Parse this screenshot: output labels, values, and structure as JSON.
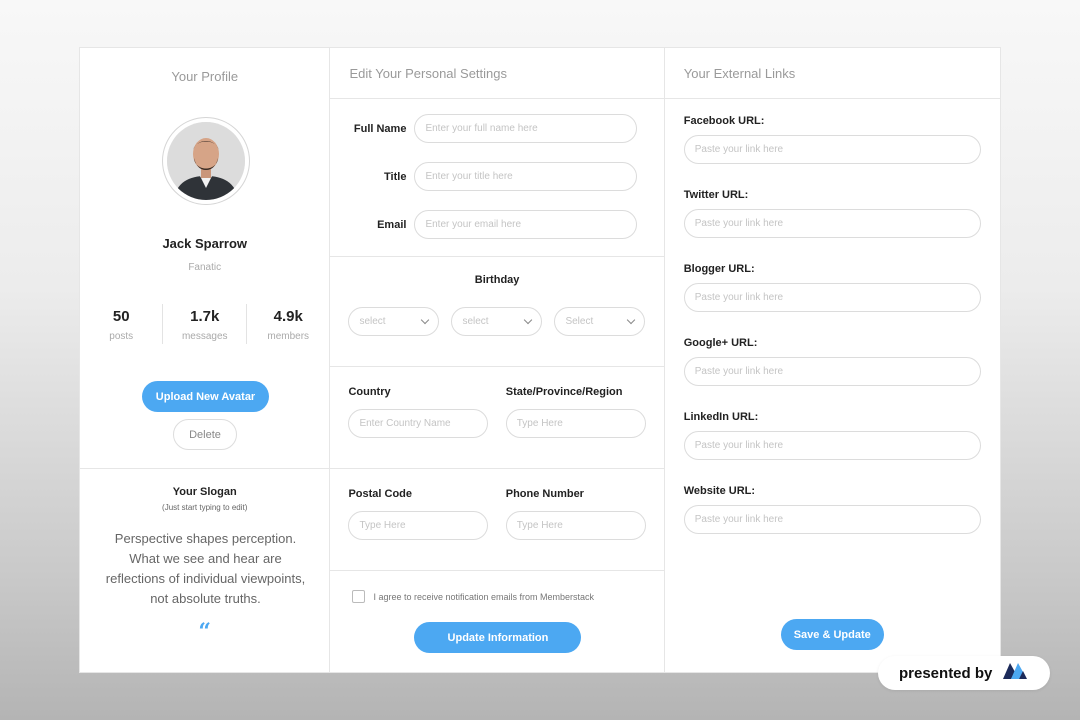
{
  "profile": {
    "heading": "Your Profile",
    "name": "Jack Sparrow",
    "role": "Fanatic",
    "stats": [
      {
        "value": "50",
        "label": "posts"
      },
      {
        "value": "1.7k",
        "label": "messages"
      },
      {
        "value": "4.9k",
        "label": "members"
      }
    ],
    "upload_label": "Upload New Avatar",
    "delete_label": "Delete"
  },
  "slogan": {
    "title": "Your Slogan",
    "hint": "(Just start typing to edit)",
    "text": "Perspective shapes perception. What we see and hear are reflections of individual viewpoints, not absolute truths."
  },
  "settings": {
    "heading": "Edit Your Personal Settings",
    "full_name": {
      "label": "Full Name",
      "placeholder": "Enter your full name here"
    },
    "title": {
      "label": "Title",
      "placeholder": "Enter your title here"
    },
    "email": {
      "label": "Email",
      "placeholder": "Enter your email here"
    },
    "birthday": {
      "label": "Birthday",
      "selects": [
        "select",
        "select",
        "Select"
      ]
    },
    "country": {
      "label": "Country",
      "placeholder": "Enter Country Name"
    },
    "state": {
      "label": "State/Province/Region",
      "placeholder": "Type Here"
    },
    "postal": {
      "label": "Postal Code",
      "placeholder": "Type Here"
    },
    "phone": {
      "label": "Phone Number",
      "placeholder": "Type Here"
    },
    "agree_text": "I agree to receive notification emails from Memberstack",
    "update_label": "Update Information"
  },
  "links": {
    "heading": "Your External Links",
    "items": [
      {
        "label": "Facebook URL:",
        "placeholder": "Paste your link here"
      },
      {
        "label": "Twitter URL:",
        "placeholder": "Paste your link here"
      },
      {
        "label": "Blogger URL:",
        "placeholder": "Paste your link here"
      },
      {
        "label": "Google+ URL:",
        "placeholder": "Paste your link here"
      },
      {
        "label": "LinkedIn URL:",
        "placeholder": "Paste your link here"
      },
      {
        "label": "Website URL:",
        "placeholder": "Paste your link here"
      }
    ],
    "save_label": "Save & Update"
  },
  "badge": {
    "text": "presented by"
  },
  "colors": {
    "accent": "#4ca8f2",
    "logo_dark": "#1c2a5a"
  }
}
